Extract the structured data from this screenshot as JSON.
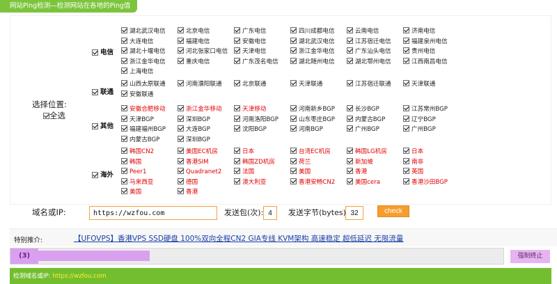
{
  "header": {
    "title": "网站Ping检测—检测网站在各地的Ping值"
  },
  "location": {
    "label": "选择位置:",
    "select_all": "全选"
  },
  "groups": [
    {
      "label": "电信",
      "items": [
        {
          "text": "湖北武汉电信",
          "red": false
        },
        {
          "text": "北京电信",
          "red": false
        },
        {
          "text": "广东电信",
          "red": false
        },
        {
          "text": "四川成都电信",
          "red": false
        },
        {
          "text": "云南电信",
          "red": false
        },
        {
          "text": "济南电信",
          "red": false
        },
        {
          "text": "大连电信",
          "red": false
        },
        {
          "text": "福建电信",
          "red": false
        },
        {
          "text": "安徽电信",
          "red": false
        },
        {
          "text": "湖北武汉电信",
          "red": false
        },
        {
          "text": "江苏宿迁电信",
          "red": false
        },
        {
          "text": "福建泉州电信",
          "red": false
        },
        {
          "text": "湖北十堰电信",
          "red": false
        },
        {
          "text": "河北张家口电信",
          "red": false
        },
        {
          "text": "天津电信",
          "red": false
        },
        {
          "text": "浙江金华电信",
          "red": false
        },
        {
          "text": "广东汕头电信",
          "red": false
        },
        {
          "text": "贵州电信",
          "red": false
        },
        {
          "text": "浙江金华电信",
          "red": false
        },
        {
          "text": "重庆电信",
          "red": false
        },
        {
          "text": "广东茂名电信",
          "red": false
        },
        {
          "text": "湖北随州电信",
          "red": false
        },
        {
          "text": "湖北鄂州电信",
          "red": false
        },
        {
          "text": "江西南昌电信",
          "red": false
        },
        {
          "text": "上海电信",
          "red": false
        }
      ]
    },
    {
      "label": "联通",
      "items": [
        {
          "text": "山西太原联通",
          "red": false
        },
        {
          "text": "河南濮阳联通",
          "red": false
        },
        {
          "text": "北京联通",
          "red": false
        },
        {
          "text": "天津联通",
          "red": false
        },
        {
          "text": "江苏宿迁联通",
          "red": false
        },
        {
          "text": "天津联通",
          "red": false
        },
        {
          "text": "安徽联通",
          "red": false
        }
      ]
    },
    {
      "label": "其他",
      "items": [
        {
          "text": "安徽合肥移动",
          "red": true
        },
        {
          "text": "浙江金华移动",
          "red": true
        },
        {
          "text": "天津移动",
          "red": true
        },
        {
          "text": "河南新乡BGP",
          "red": false
        },
        {
          "text": "长沙BGP",
          "red": false
        },
        {
          "text": "江苏常州BGP",
          "red": false
        },
        {
          "text": "天津BGP",
          "red": false
        },
        {
          "text": "深圳BGP",
          "red": false
        },
        {
          "text": "河南洛阳BGP",
          "red": false
        },
        {
          "text": "山东枣庄BGP",
          "red": false
        },
        {
          "text": "内蒙古BGP",
          "red": false
        },
        {
          "text": "辽宁BGP",
          "red": false
        },
        {
          "text": "福建福州BGP",
          "red": false
        },
        {
          "text": "大连BGP",
          "red": false
        },
        {
          "text": "沈阳BGP",
          "red": false
        },
        {
          "text": "河南BGP",
          "red": false
        },
        {
          "text": "广州BGP",
          "red": false
        },
        {
          "text": "广州BGP",
          "red": false
        },
        {
          "text": "内蒙古BGP",
          "red": false
        },
        {
          "text": "深圳BGP",
          "red": false
        }
      ]
    },
    {
      "label": "海外",
      "items": [
        {
          "text": "韩国CN2",
          "red": true
        },
        {
          "text": "美国EC机房",
          "red": true
        },
        {
          "text": "日本",
          "red": true
        },
        {
          "text": "台湾EC机房",
          "red": true
        },
        {
          "text": "韩国LG机房",
          "red": true
        },
        {
          "text": "日本",
          "red": true
        },
        {
          "text": "韩国",
          "red": true
        },
        {
          "text": "香港SIM",
          "red": true
        },
        {
          "text": "韩国ZD机房",
          "red": true
        },
        {
          "text": "荷兰",
          "red": true
        },
        {
          "text": "新加坡",
          "red": true
        },
        {
          "text": "南非",
          "red": true
        },
        {
          "text": "Peer1",
          "red": true
        },
        {
          "text": "Quadranet2",
          "red": true
        },
        {
          "text": "法国",
          "red": true
        },
        {
          "text": "美国",
          "red": true
        },
        {
          "text": "香港",
          "red": true
        },
        {
          "text": "英国",
          "red": true
        },
        {
          "text": "马来西亚",
          "red": true
        },
        {
          "text": "德国",
          "red": true
        },
        {
          "text": "澳大利亚",
          "red": true
        },
        {
          "text": "香港安畅CN2",
          "red": true
        },
        {
          "text": "美国cera",
          "red": true
        },
        {
          "text": "香港沙田BGP",
          "red": true
        },
        {
          "text": "美国",
          "red": true
        },
        {
          "text": "香港",
          "red": true
        }
      ]
    }
  ],
  "form": {
    "domain_label": "域名或IP:",
    "domain_value": "https://wzfou.com",
    "send_label": "发送包(次):",
    "send_value": "4",
    "bytes_label": "发送字节(bytes):",
    "bytes_value": "32",
    "check_label": "check"
  },
  "promo": {
    "label": "特别推介:",
    "link": "【UFOVPS】香港VPS SSD硬盘 100%双向全程CN2 GIA专线 KVM架构 高速稳定 超低延迟 无限流量"
  },
  "progress": {
    "count": "(3)",
    "fraction": 0.24,
    "stop_label": "强制终止"
  },
  "result": {
    "label": "检测域名或IP:",
    "domain": "https://wzfou.com"
  },
  "colors": {
    "green": "#7cc43c",
    "red_text": "#e00000",
    "orange": "#f69d2d",
    "progress": "#d9a0f0"
  }
}
